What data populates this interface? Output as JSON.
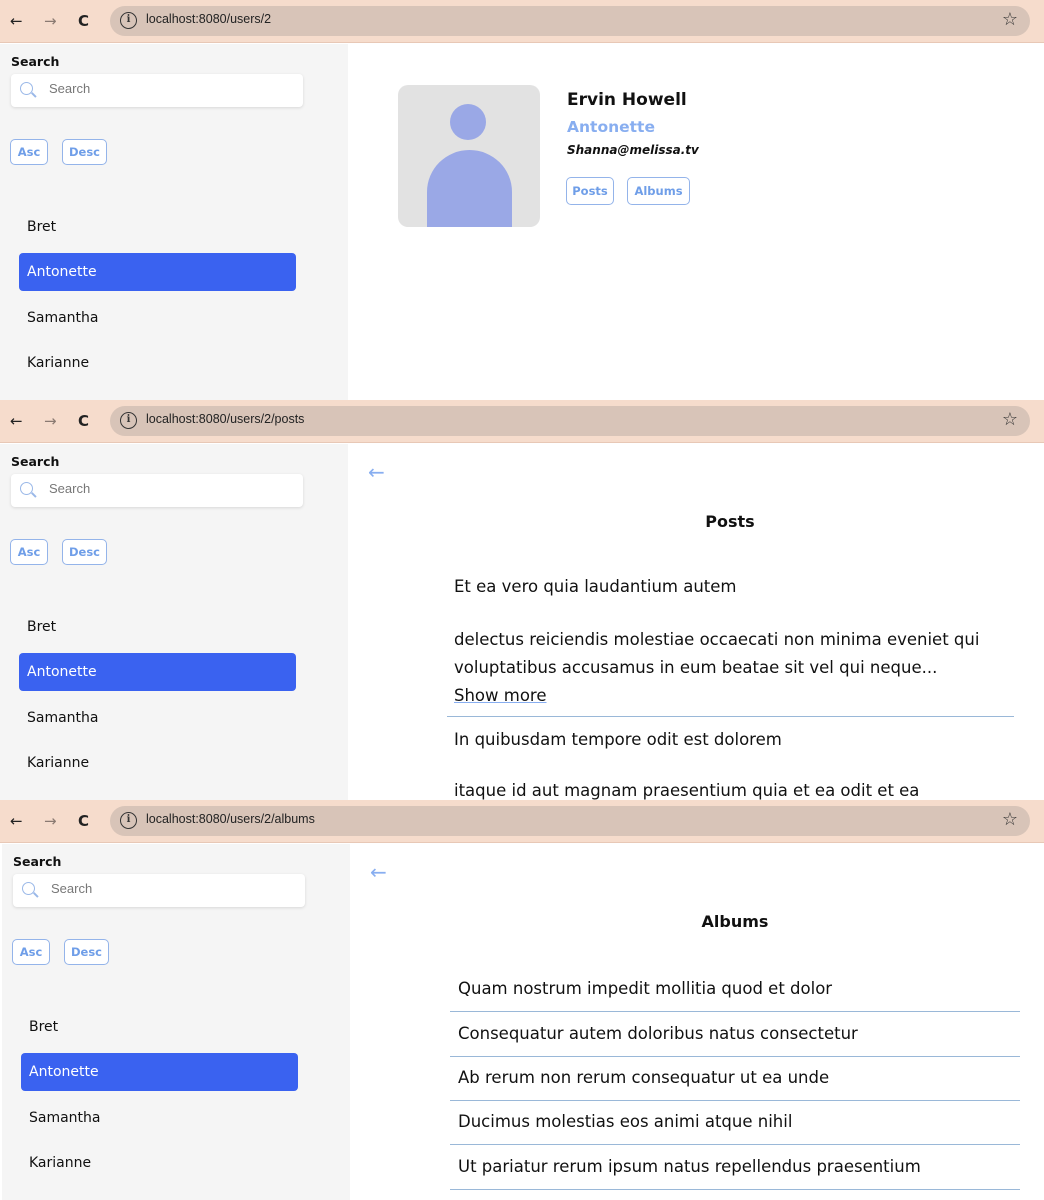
{
  "browser": {
    "url_profile": "localhost:8080/users/2",
    "url_posts": "localhost:8080/users/2/posts",
    "url_albums": "localhost:8080/users/2/albums",
    "back_icon": "←",
    "forward_icon": "→",
    "reload_icon": "C",
    "info_icon": "i",
    "star_icon": "☆"
  },
  "sidebar": {
    "search_label": "Search",
    "search_placeholder": "Search",
    "sort_asc": "Asc",
    "sort_desc": "Desc",
    "users": [
      "Bret",
      "Antonette",
      "Samantha",
      "Karianne"
    ],
    "active_user": "Antonette"
  },
  "profile": {
    "name": "Ervin Howell",
    "username": "Antonette",
    "email": "Shanna@melissa.tv",
    "posts_button": "Posts",
    "albums_button": "Albums"
  },
  "posts": {
    "back_icon": "←",
    "title": "Posts",
    "items": [
      {
        "title": "Et ea vero quia laudantium autem",
        "body": "delectus reiciendis molestiae occaecati non minima eveniet qui voluptatibus accusamus in eum beatae sit vel qui neque...",
        "show_more": "Show more"
      },
      {
        "title": "In quibusdam tempore odit est dolorem",
        "body": "itaque id aut magnam praesentium quia et ea odit et ea"
      }
    ]
  },
  "albums": {
    "back_icon": "←",
    "title": "Albums",
    "items": [
      "Quam nostrum impedit mollitia quod et dolor",
      "Consequatur autem doloribus natus consectetur",
      "Ab rerum non rerum consequatur ut ea unde",
      "Ducimus molestias eos animi atque nihil",
      "Ut pariatur rerum ipsum natus repellendus praesentium"
    ]
  }
}
